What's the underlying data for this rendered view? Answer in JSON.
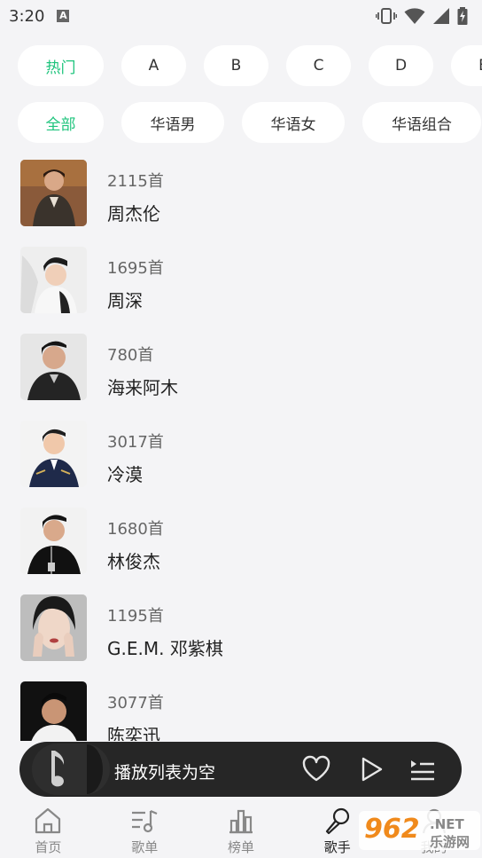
{
  "status_bar": {
    "time": "3:20",
    "notification_icon": "A"
  },
  "filters": {
    "letters": [
      {
        "label": "热门",
        "active": true
      },
      {
        "label": "A",
        "active": false
      },
      {
        "label": "B",
        "active": false
      },
      {
        "label": "C",
        "active": false
      },
      {
        "label": "D",
        "active": false
      },
      {
        "label": "E",
        "active": false
      }
    ],
    "categories": [
      {
        "label": "全部",
        "active": true
      },
      {
        "label": "华语男",
        "active": false
      },
      {
        "label": "华语女",
        "active": false
      },
      {
        "label": "华语组合",
        "active": false
      }
    ]
  },
  "artists": [
    {
      "count": "2115首",
      "name": "周杰伦"
    },
    {
      "count": "1695首",
      "name": "周深"
    },
    {
      "count": "780首",
      "name": "海来阿木"
    },
    {
      "count": "3017首",
      "name": "冷漠"
    },
    {
      "count": "1680首",
      "name": "林俊杰"
    },
    {
      "count": "1195首",
      "name": "G.E.M. 邓紫棋"
    },
    {
      "count": "3077首",
      "name": "陈奕迅"
    }
  ],
  "player": {
    "status_text": "播放列表为空"
  },
  "tabs": [
    {
      "label": "首页",
      "icon": "home-icon",
      "active": false
    },
    {
      "label": "歌单",
      "icon": "playlist-icon",
      "active": false
    },
    {
      "label": "榜单",
      "icon": "chart-icon",
      "active": false
    },
    {
      "label": "歌手",
      "icon": "microphone-icon",
      "active": true
    },
    {
      "label": "我的",
      "icon": "user-icon",
      "active": false
    }
  ],
  "watermark": {
    "number": "962",
    "suffix": ".NET",
    "site": "乐游网"
  },
  "colors": {
    "accent": "#1fc47d",
    "background": "#f4f4f6",
    "player_bg": "#262626"
  }
}
